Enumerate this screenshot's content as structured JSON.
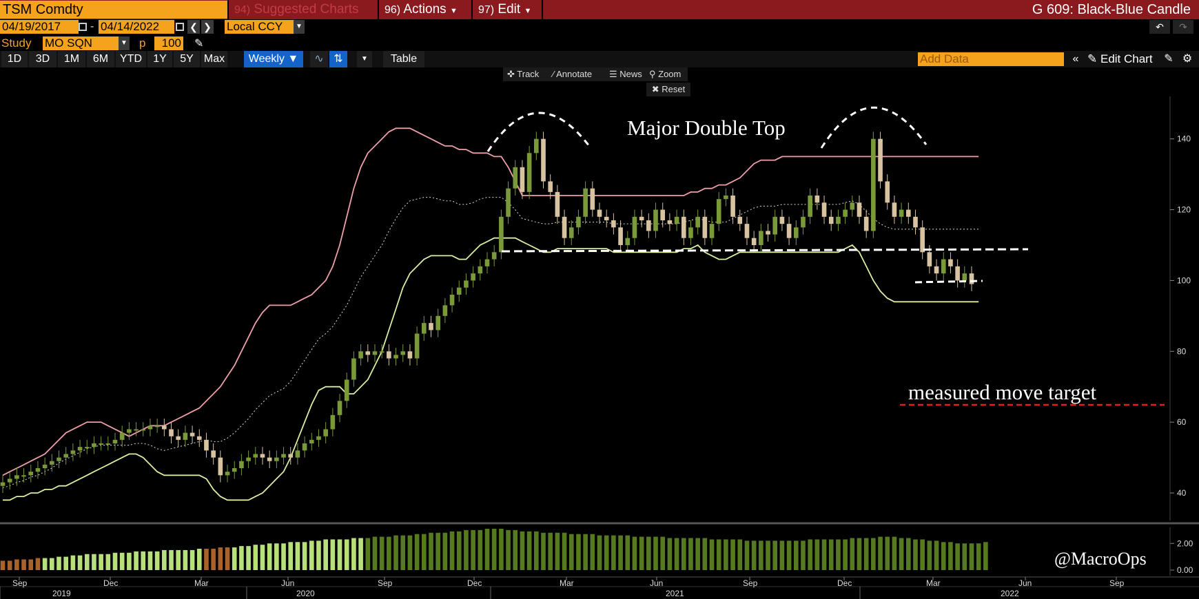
{
  "topbar": {
    "ticker": "TSM Comdty",
    "suggested_num": "94)",
    "suggested_label": "Suggested Charts",
    "actions_num": "96)",
    "actions_label": "Actions",
    "edit_num": "97)",
    "edit_label": "Edit",
    "chart_title": "G 609: Black-Blue Candle"
  },
  "range": {
    "start_date": "04/19/2017",
    "end_date": "04/14/2022",
    "dash": "-",
    "currency": "Local CCY"
  },
  "study": {
    "label": "Study",
    "name": "MO SQN",
    "p_label": "p",
    "p_value": "100"
  },
  "toolbar": {
    "periods": [
      "1D",
      "3D",
      "1M",
      "6M",
      "YTD",
      "1Y",
      "5Y",
      "Max"
    ],
    "frequency": "Weekly",
    "table_label": "Table",
    "add_data_placeholder": "Add Data",
    "edit_chart_label": "Edit Chart"
  },
  "chart_tools": {
    "track": "Track",
    "annotate": "Annotate",
    "news": "News",
    "zoom": "Zoom",
    "reset": "Reset"
  },
  "annotations": {
    "double_top": "Major Double Top",
    "target": "measured move target",
    "watermark": "@MacroOps"
  },
  "colors": {
    "bull_candle": "#7a9a3a",
    "bear_candle": "#d8c3a0",
    "upper_band": "#f0a0a8",
    "lower_band": "#d9f0a3",
    "volume": "#6b8e23",
    "ticker_bg": "#f5a21c",
    "topbar_bg": "#8b1a1f"
  },
  "chart_data": {
    "type": "candlestick",
    "ylim": [
      33,
      152
    ],
    "y_ticks": [
      40,
      60,
      80,
      100,
      120,
      140
    ],
    "x_ticks": [
      {
        "date": "2019-09",
        "label": "Sep"
      },
      {
        "date": "2019-12",
        "label": "Dec"
      },
      {
        "date": "2020-03",
        "label": "Mar"
      },
      {
        "date": "2020-06",
        "label": "Jun"
      },
      {
        "date": "2020-09",
        "label": "Sep"
      },
      {
        "date": "2020-12",
        "label": "Dec"
      },
      {
        "date": "2021-03",
        "label": "Mar"
      },
      {
        "date": "2021-06",
        "label": "Jun"
      },
      {
        "date": "2021-09",
        "label": "Sep"
      },
      {
        "date": "2021-12",
        "label": "Dec"
      },
      {
        "date": "2022-03",
        "label": "Mar"
      },
      {
        "date": "2022-06",
        "label": "Jun"
      },
      {
        "date": "2022-09",
        "label": "Sep"
      }
    ],
    "year_labels": [
      "2019",
      "2020",
      "2021",
      "2022"
    ],
    "closes": [
      43,
      44,
      45,
      45,
      46,
      47,
      48,
      49,
      50,
      51,
      52,
      53,
      53,
      54,
      54,
      54,
      55,
      57,
      58,
      58,
      58,
      59,
      59,
      58,
      56,
      55,
      57,
      56,
      55,
      52,
      50,
      45,
      46,
      47,
      49,
      50,
      51,
      50,
      49,
      50,
      51,
      50,
      52,
      54,
      55,
      56,
      58,
      62,
      66,
      72,
      78,
      80,
      79,
      80,
      80,
      78,
      79,
      80,
      78,
      85,
      88,
      86,
      90,
      93,
      96,
      98,
      100,
      102,
      104,
      106,
      108,
      118,
      126,
      132,
      125,
      136,
      140,
      128,
      125,
      118,
      112,
      115,
      118,
      126,
      120,
      118,
      117,
      115,
      110,
      112,
      118,
      117,
      114,
      120,
      117,
      116,
      118,
      112,
      115,
      118,
      112,
      116,
      123,
      124,
      118,
      116,
      112,
      110,
      114,
      113,
      118,
      116,
      112,
      115,
      118,
      124,
      122,
      118,
      116,
      118,
      120,
      122,
      118,
      114,
      140,
      128,
      122,
      118,
      120,
      118,
      115,
      108,
      104,
      102,
      106,
      104,
      100,
      102,
      99
    ],
    "opens": [
      42,
      43,
      44,
      45,
      45,
      46,
      47,
      48,
      49,
      50,
      51,
      52,
      53,
      53,
      54,
      54,
      54,
      55,
      57,
      58,
      58,
      58,
      59,
      59,
      58,
      56,
      55,
      57,
      56,
      55,
      52,
      50,
      45,
      46,
      47,
      49,
      50,
      51,
      50,
      49,
      50,
      51,
      50,
      52,
      54,
      55,
      56,
      58,
      62,
      66,
      72,
      78,
      80,
      79,
      80,
      80,
      78,
      79,
      80,
      78,
      85,
      88,
      86,
      90,
      93,
      96,
      98,
      100,
      102,
      104,
      106,
      108,
      118,
      126,
      132,
      125,
      136,
      140,
      128,
      125,
      118,
      112,
      115,
      118,
      126,
      120,
      118,
      117,
      115,
      110,
      112,
      118,
      117,
      114,
      120,
      117,
      116,
      118,
      112,
      115,
      118,
      112,
      116,
      123,
      124,
      118,
      116,
      112,
      110,
      114,
      113,
      118,
      116,
      112,
      115,
      118,
      124,
      122,
      118,
      116,
      118,
      120,
      122,
      118,
      114,
      140,
      128,
      122,
      118,
      120,
      118,
      115,
      108,
      104,
      102,
      106,
      104,
      100,
      102
    ],
    "series": [
      {
        "name": "upper",
        "values": [
          45,
          46,
          47,
          48,
          49,
          50,
          51,
          53,
          55,
          57,
          58,
          59,
          60,
          60,
          60,
          59,
          58,
          57,
          56,
          57,
          58,
          59,
          59,
          59,
          60,
          61,
          62,
          63,
          64,
          66,
          68,
          70,
          73,
          76,
          80,
          84,
          88,
          91,
          93,
          93,
          93,
          93,
          94,
          95,
          96,
          98,
          100,
          104,
          110,
          118,
          126,
          132,
          136,
          138,
          140,
          142,
          143,
          143,
          143,
          142,
          141,
          140,
          139,
          138,
          138,
          137,
          137,
          136,
          136,
          136,
          135,
          135,
          132,
          128,
          124,
          124,
          124,
          124,
          124,
          124,
          124,
          124,
          124,
          124,
          124,
          124,
          124,
          124,
          124,
          124,
          124,
          124,
          124,
          124,
          124,
          124,
          124,
          124,
          125,
          125,
          126,
          126,
          127,
          127,
          128,
          129,
          131,
          133,
          134,
          134,
          134,
          135,
          135,
          135,
          135,
          135,
          135,
          135,
          135,
          135,
          135,
          135,
          135,
          135,
          135,
          135,
          135,
          135,
          135,
          135,
          135,
          135,
          135,
          135,
          135,
          135,
          135,
          135,
          135,
          135
        ]
      },
      {
        "name": "lower",
        "values": [
          38,
          38,
          39,
          39,
          40,
          40,
          41,
          41,
          42,
          42,
          43,
          44,
          45,
          46,
          47,
          48,
          49,
          50,
          51,
          51,
          50,
          48,
          46,
          45,
          45,
          45,
          45,
          45,
          45,
          44,
          41,
          39,
          38,
          38,
          38,
          38,
          39,
          40,
          42,
          44,
          46,
          50,
          55,
          60,
          65,
          69,
          70,
          70,
          70,
          68,
          68,
          70,
          72,
          76,
          80,
          86,
          92,
          98,
          102,
          104,
          106,
          107,
          107,
          107,
          107,
          106,
          106,
          108,
          110,
          111,
          112,
          112,
          112,
          112,
          111,
          110,
          109,
          108,
          108,
          109,
          109,
          109,
          109,
          109,
          109,
          109,
          109,
          108,
          108,
          108,
          108,
          108,
          108,
          108,
          108,
          108,
          108,
          109,
          109,
          110,
          108,
          107,
          106,
          106,
          107,
          108,
          108,
          108,
          108,
          108,
          108,
          108,
          108,
          108,
          108,
          108,
          108,
          108,
          108,
          108,
          109,
          110,
          108,
          104,
          100,
          97,
          95,
          94,
          94,
          94,
          94,
          94,
          94,
          94,
          94,
          94,
          94,
          94,
          94,
          94
        ]
      }
    ],
    "volume_ticks": [
      "2.00",
      "0.00"
    ],
    "volume_levels": [
      0.7,
      0.7,
      0.8,
      0.8,
      0.8,
      0.9,
      0.9,
      0.9,
      1.0,
      1.0,
      1.1,
      1.1,
      1.2,
      1.2,
      1.2,
      1.2,
      1.3,
      1.3,
      1.3,
      1.4,
      1.4,
      1.4,
      1.4,
      1.5,
      1.5,
      1.5,
      1.5,
      1.5,
      1.6,
      1.6,
      1.6,
      1.7,
      1.7,
      1.7,
      1.8,
      1.8,
      1.9,
      1.9,
      2.0,
      2.0,
      2.0,
      2.1,
      2.1,
      2.1,
      2.2,
      2.2,
      2.3,
      2.3,
      2.3,
      2.3,
      2.4,
      2.4,
      2.4,
      2.5,
      2.5,
      2.5,
      2.6,
      2.6,
      2.6,
      2.7,
      2.7,
      2.8,
      2.8,
      2.8,
      2.9,
      2.9,
      3.0,
      3.0,
      3.0,
      3.1,
      3.1,
      3.1,
      3.0,
      3.0,
      2.9,
      2.9,
      2.9,
      2.8,
      2.8,
      2.8,
      2.8,
      2.7,
      2.7,
      2.7,
      2.7,
      2.6,
      2.6,
      2.6,
      2.6,
      2.6,
      2.5,
      2.5,
      2.5,
      2.5,
      2.5,
      2.4,
      2.4,
      2.4,
      2.4,
      2.4,
      2.4,
      2.3,
      2.3,
      2.3,
      2.3,
      2.3,
      2.2,
      2.2,
      2.2,
      2.2,
      2.2,
      2.2,
      2.2,
      2.2,
      2.2,
      2.3,
      2.3,
      2.3,
      2.3,
      2.3,
      2.3,
      2.4,
      2.4,
      2.4,
      2.4,
      2.5,
      2.5,
      2.5,
      2.4,
      2.4,
      2.3,
      2.3,
      2.2,
      2.2,
      2.1,
      2.1,
      2.0,
      2.0,
      2.0,
      2.0,
      2.1
    ]
  }
}
